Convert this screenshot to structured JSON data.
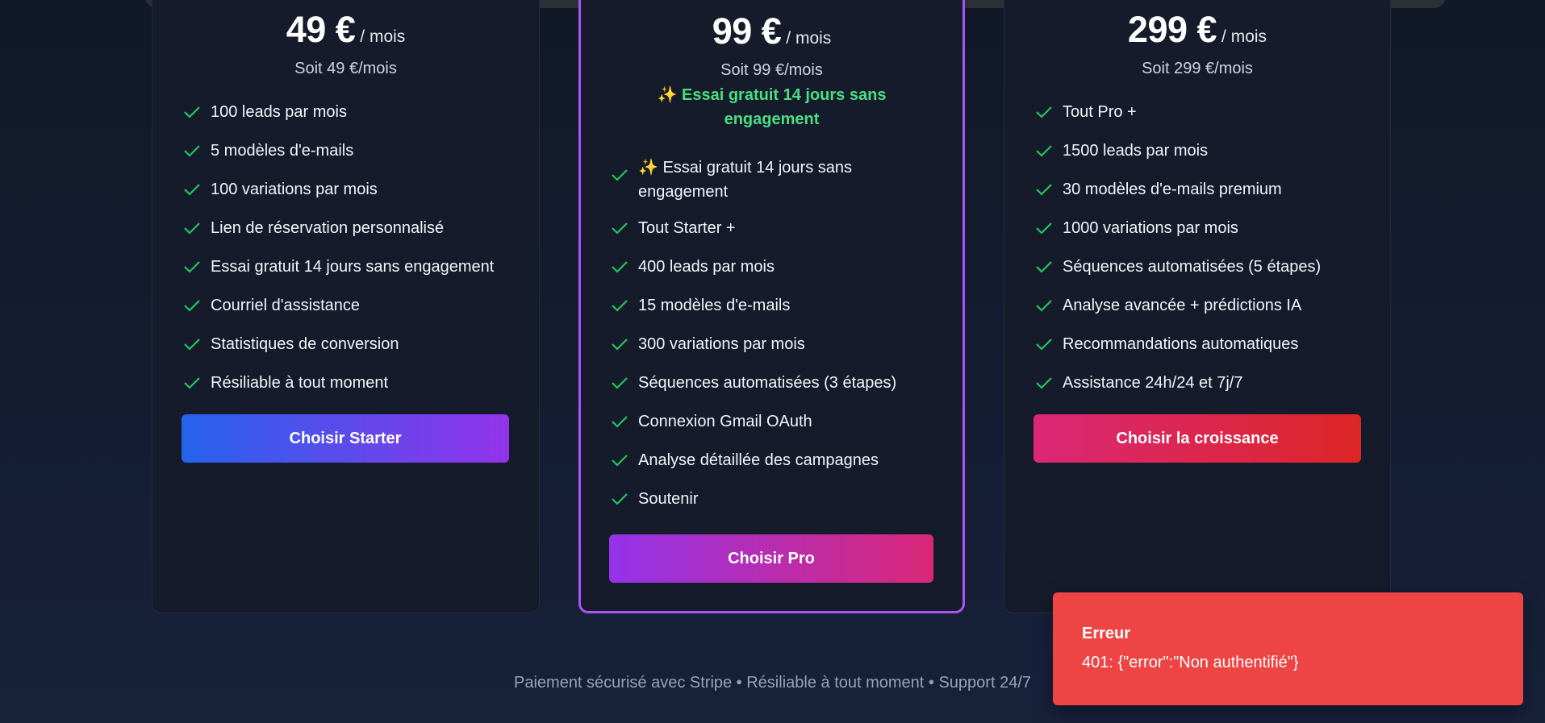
{
  "plans": [
    {
      "price": "49 €",
      "period": "/ mois",
      "subtitle": "Soit 49 €/mois",
      "features": [
        "100 leads par mois",
        "5 modèles d'e-mails",
        "100 variations par mois",
        "Lien de réservation personnalisé",
        "Essai gratuit 14 jours sans engagement",
        "Courriel d'assistance",
        "Statistiques de conversion",
        "Résiliable à tout moment"
      ],
      "button_label": "Choisir Starter"
    },
    {
      "price": "99 €",
      "period": "/ mois",
      "subtitle": "Soit 99 €/mois",
      "trial_line1": "✨ Essai gratuit 14 jours sans",
      "trial_line2": "engagement",
      "first_feature_line1": "✨ Essai gratuit 14 jours sans",
      "first_feature_line2": "engagement",
      "features": [
        "Tout Starter +",
        "400 leads par mois",
        "15 modèles d'e-mails",
        "300 variations par mois",
        "Séquences automatisées (3 étapes)",
        "Connexion Gmail OAuth",
        "Analyse détaillée des campagnes",
        "Soutenir"
      ],
      "button_label": "Choisir Pro"
    },
    {
      "price": "299 €",
      "period": "/ mois",
      "subtitle": "Soit 299 €/mois",
      "features": [
        "Tout Pro +",
        "1500 leads par mois",
        "30 modèles d'e-mails premium",
        "1000 variations par mois",
        "Séquences automatisées (5 étapes)",
        "Analyse avancée + prédictions IA",
        "Recommandations automatiques",
        "Assistance 24h/24 et 7j/7"
      ],
      "button_label": "Choisir la croissance"
    }
  ],
  "footer": "Paiement sécurisé avec Stripe • Résiliable à tout moment • Support 24/7",
  "toast": {
    "title": "Erreur",
    "message": "401: {\"error\":\"Non authentifié\"}"
  },
  "colors": {
    "check": "#22c55e",
    "trial_text": "#4ade80",
    "pro_border": "#a855f7",
    "toast_bg": "#ef4444"
  }
}
